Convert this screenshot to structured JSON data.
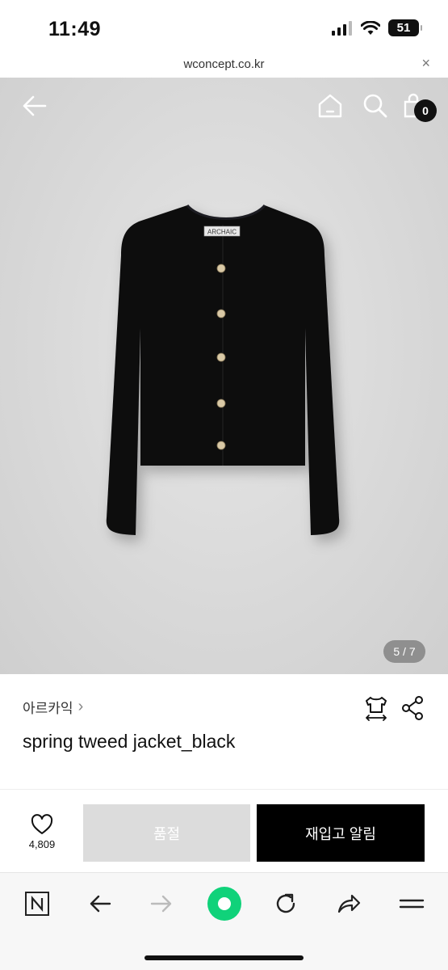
{
  "status_bar": {
    "time": "11:49",
    "battery": "51"
  },
  "browser": {
    "url": "wconcept.co.kr",
    "close_label": "×"
  },
  "header": {
    "cart_count": "0"
  },
  "gallery": {
    "page_indicator": "5 / 7",
    "jacket_label": "ARCHAIC"
  },
  "product": {
    "brand": "아르카익",
    "brand_chevron": "›",
    "title": "spring tweed jacket_black"
  },
  "actions": {
    "like_count": "4,809",
    "sold_out_label": "품절",
    "restock_label": "재입고 알림"
  },
  "colors": {
    "accent_green": "#10d27a",
    "dark": "#000000",
    "disabled": "#dcdcdc"
  }
}
